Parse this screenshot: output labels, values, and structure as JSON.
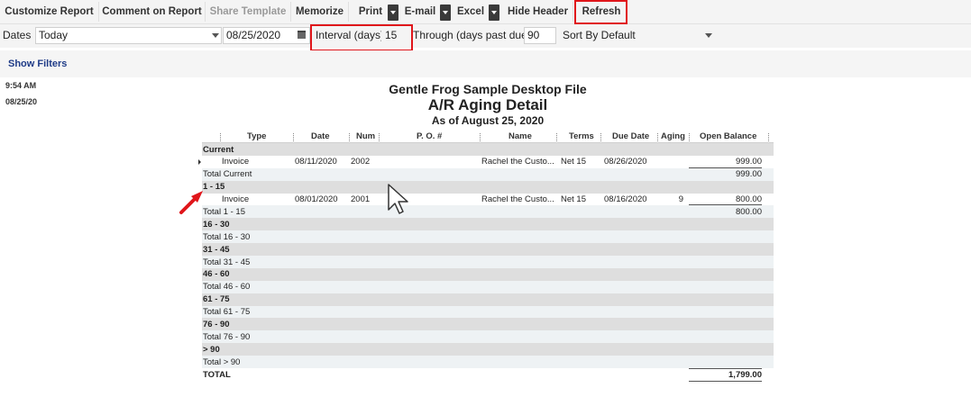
{
  "toolbar": {
    "customize": "Customize Report",
    "comment": "Comment on Report",
    "share": "Share Template",
    "memorize": "Memorize",
    "print": "Print",
    "email": "E-mail",
    "excel": "Excel",
    "hide_header": "Hide Header",
    "refresh": "Refresh"
  },
  "filters": {
    "dates_label": "Dates",
    "dates_value": "Today",
    "date_value": "08/25/2020",
    "interval_label": "Interval (days)",
    "interval_value": "15",
    "through_label": "Through (days past due)",
    "through_value": "90",
    "sort_value": "Sort By Default",
    "show_filters": "Show Filters"
  },
  "meta": {
    "time": "9:54 AM",
    "date": "08/25/20"
  },
  "header": {
    "company": "Gentle Frog Sample Desktop File",
    "title": "A/R Aging Detail",
    "as_of": "As of August 25, 2020"
  },
  "columns": [
    "Type",
    "Date",
    "Num",
    "P. O. #",
    "Name",
    "Terms",
    "Due Date",
    "Aging",
    "Open Balance"
  ],
  "rows": [
    {
      "kind": "section",
      "label": "Current"
    },
    {
      "kind": "data",
      "type": "Invoice",
      "date": "08/11/2020",
      "num": "2002",
      "po": "",
      "name": "Rachel the Custo...",
      "terms": "Net 15",
      "due": "08/26/2020",
      "aging": "",
      "balance": "999.00"
    },
    {
      "kind": "total",
      "label": "Total Current",
      "balance": "999.00"
    },
    {
      "kind": "section",
      "label": "1 - 15"
    },
    {
      "kind": "data",
      "type": "Invoice",
      "date": "08/01/2020",
      "num": "2001",
      "po": "",
      "name": "Rachel the Custo...",
      "terms": "Net 15",
      "due": "08/16/2020",
      "aging": "9",
      "balance": "800.00"
    },
    {
      "kind": "total",
      "label": "Total 1 - 15",
      "balance": "800.00"
    },
    {
      "kind": "section",
      "label": "16 - 30"
    },
    {
      "kind": "total",
      "label": "Total 16 - 30",
      "balance": ""
    },
    {
      "kind": "section",
      "label": "31 - 45"
    },
    {
      "kind": "total",
      "label": "Total 31 - 45",
      "balance": ""
    },
    {
      "kind": "section",
      "label": "46 - 60"
    },
    {
      "kind": "total",
      "label": "Total 46 - 60",
      "balance": ""
    },
    {
      "kind": "section",
      "label": "61 - 75"
    },
    {
      "kind": "total",
      "label": "Total 61 - 75",
      "balance": ""
    },
    {
      "kind": "section",
      "label": "76 - 90"
    },
    {
      "kind": "total",
      "label": "Total 76 - 90",
      "balance": ""
    },
    {
      "kind": "section",
      "label": "> 90"
    },
    {
      "kind": "total",
      "label": "Total > 90",
      "balance": ""
    },
    {
      "kind": "grand",
      "label": "TOTAL",
      "balance": "1,799.00"
    }
  ],
  "colors": {
    "highlight": "#e0161b",
    "link": "#1f3c88",
    "toolbar_bg": "#f4f4f4"
  }
}
